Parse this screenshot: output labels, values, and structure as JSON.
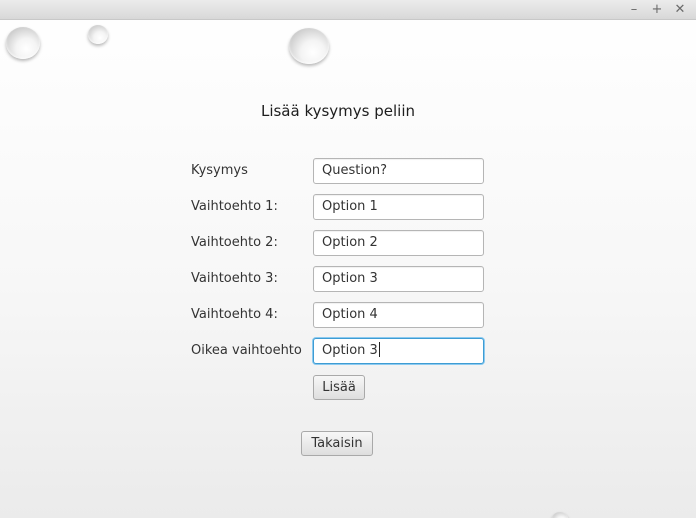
{
  "window": {
    "controls": {
      "minimize": "–",
      "maximize": "+",
      "close": "✕"
    }
  },
  "page": {
    "title": "Lisää kysymys peliin"
  },
  "form": {
    "question_label": "Kysymys",
    "question_value": "Question?",
    "option1_label": "Vaihtoehto 1:",
    "option1_value": "Option 1",
    "option2_label": "Vaihtoehto 2:",
    "option2_value": "Option 2",
    "option3_label": "Vaihtoehto 3:",
    "option3_value": "Option 3",
    "option4_label": "Vaihtoehto 4:",
    "option4_value": "Option 4",
    "correct_label": "Oikea vaihtoehto",
    "correct_value": "Option 3"
  },
  "buttons": {
    "add_label": "Lisää",
    "back_label": "Takaisin"
  },
  "decor": {
    "droplets": "water-droplet-icon"
  }
}
